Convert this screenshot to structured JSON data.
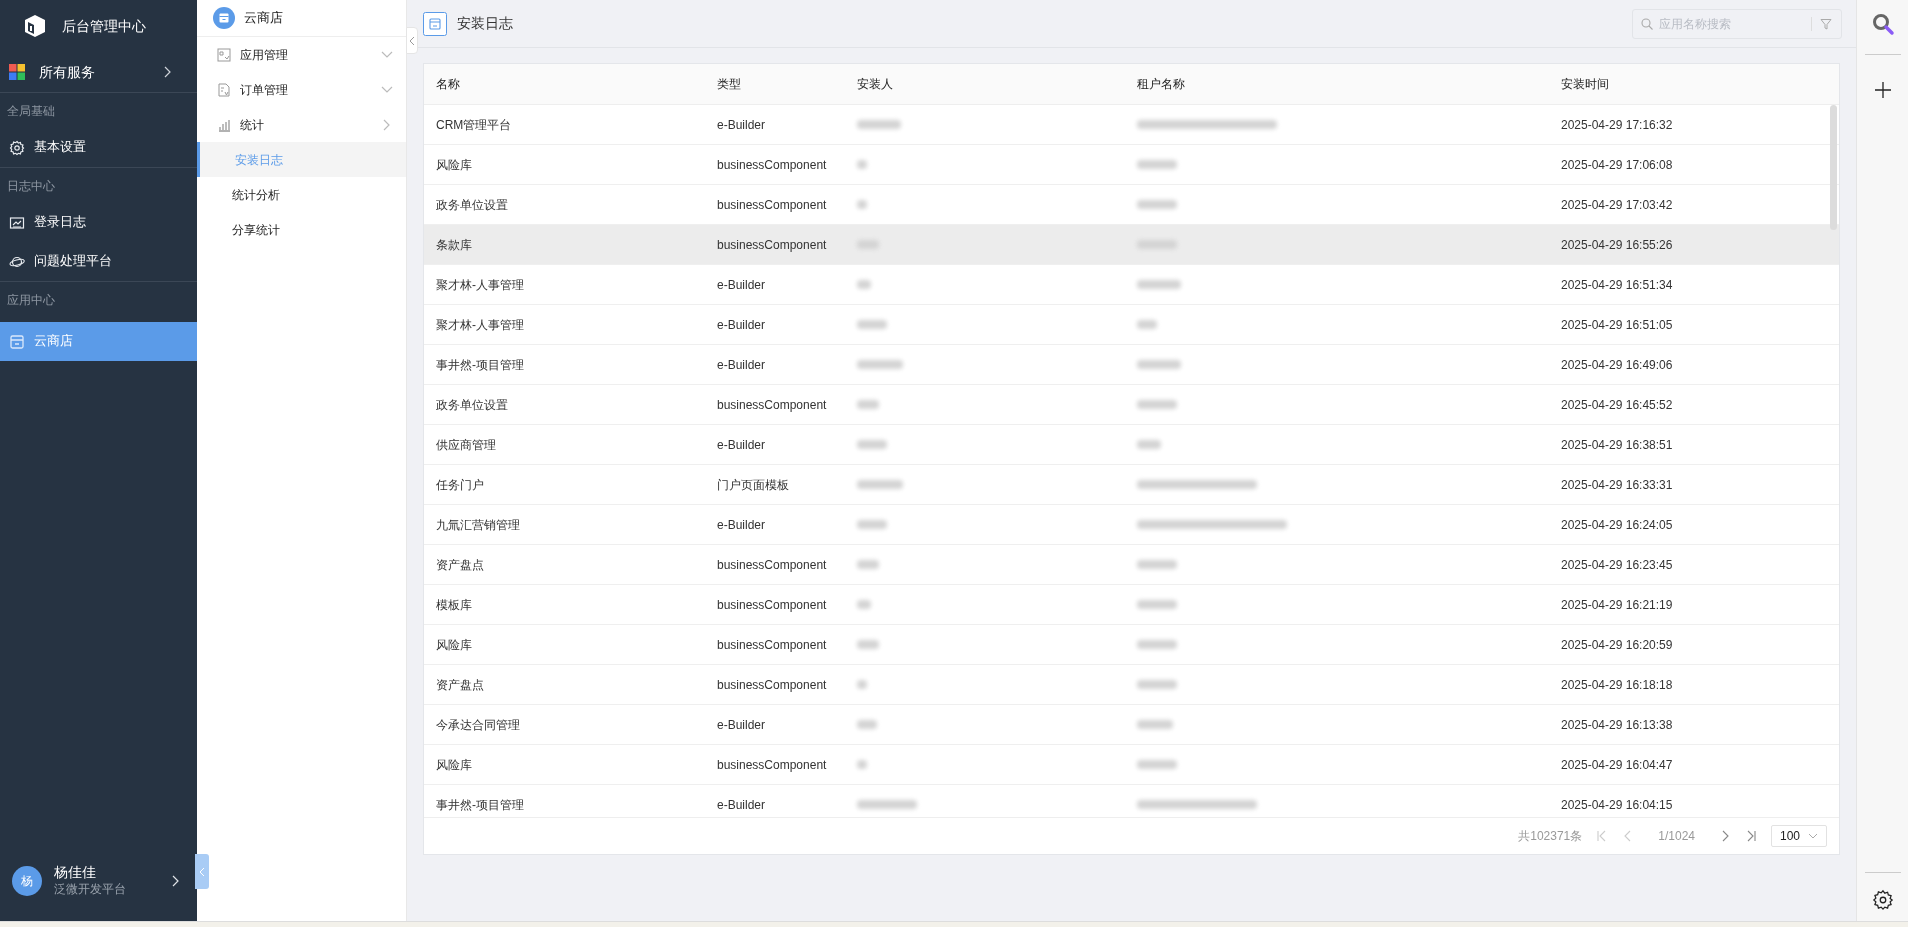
{
  "sidebar": {
    "title": "后台管理中心",
    "all_services": "所有服务",
    "sections": [
      {
        "label": "全局基础",
        "items": [
          {
            "label": "基本设置",
            "selected": false
          }
        ]
      },
      {
        "label": "日志中心",
        "items": [
          {
            "label": "登录日志",
            "selected": false
          },
          {
            "label": "问题处理平台",
            "selected": false
          }
        ]
      },
      {
        "label": "应用中心",
        "items": [
          {
            "label": "云商店",
            "selected": true
          }
        ]
      }
    ],
    "user": {
      "avatar": "杨",
      "name": "杨佳佳",
      "org": "泛微开发平台"
    }
  },
  "submenu": {
    "title": "云商店",
    "items": [
      {
        "label": "应用管理",
        "expanded": false
      },
      {
        "label": "订单管理",
        "expanded": false
      },
      {
        "label": "统计",
        "expanded": true,
        "children": [
          {
            "label": "安装日志",
            "selected": true
          },
          {
            "label": "统计分析",
            "selected": false
          },
          {
            "label": "分享统计",
            "selected": false
          }
        ]
      }
    ]
  },
  "page": {
    "title": "安装日志",
    "search": {
      "placeholder": "应用名称搜索"
    }
  },
  "table": {
    "columns": [
      "名称",
      "类型",
      "安装人",
      "租户名称",
      "安装时间"
    ],
    "rows": [
      {
        "name": "CRM管理平台",
        "type": "e-Builder",
        "time": "2025-04-29 17:16:32",
        "highlighted": false
      },
      {
        "name": "风险库",
        "type": "businessComponent",
        "time": "2025-04-29 17:06:08",
        "highlighted": false
      },
      {
        "name": "政务单位设置",
        "type": "businessComponent",
        "time": "2025-04-29 17:03:42",
        "highlighted": false
      },
      {
        "name": "条款库",
        "type": "businessComponent",
        "time": "2025-04-29 16:55:26",
        "highlighted": true
      },
      {
        "name": "聚才林-人事管理",
        "type": "e-Builder",
        "time": "2025-04-29 16:51:34",
        "highlighted": false
      },
      {
        "name": "聚才林-人事管理",
        "type": "e-Builder",
        "time": "2025-04-29 16:51:05",
        "highlighted": false
      },
      {
        "name": "事井然-项目管理",
        "type": "e-Builder",
        "time": "2025-04-29 16:49:06",
        "highlighted": false
      },
      {
        "name": "政务单位设置",
        "type": "businessComponent",
        "time": "2025-04-29 16:45:52",
        "highlighted": false
      },
      {
        "name": "供应商管理",
        "type": "e-Builder",
        "time": "2025-04-29 16:38:51",
        "highlighted": false
      },
      {
        "name": "任务门户",
        "type": "门户页面模板",
        "time": "2025-04-29 16:33:31",
        "highlighted": false
      },
      {
        "name": "九氚汇营销管理",
        "type": "e-Builder",
        "time": "2025-04-29 16:24:05",
        "highlighted": false
      },
      {
        "name": "资产盘点",
        "type": "businessComponent",
        "time": "2025-04-29 16:23:45",
        "highlighted": false
      },
      {
        "name": "模板库",
        "type": "businessComponent",
        "time": "2025-04-29 16:21:19",
        "highlighted": false
      },
      {
        "name": "风险库",
        "type": "businessComponent",
        "time": "2025-04-29 16:20:59",
        "highlighted": false
      },
      {
        "name": "资产盘点",
        "type": "businessComponent",
        "time": "2025-04-29 16:18:18",
        "highlighted": false
      },
      {
        "name": "今承达合同管理",
        "type": "e-Builder",
        "time": "2025-04-29 16:13:38",
        "highlighted": false
      },
      {
        "name": "风险库",
        "type": "businessComponent",
        "time": "2025-04-29 16:04:47",
        "highlighted": false
      },
      {
        "name": "事井然-项目管理",
        "type": "e-Builder",
        "time": "2025-04-29 16:04:15",
        "highlighted": false
      }
    ]
  },
  "pagination": {
    "total": "共102371条",
    "page": "1/1024",
    "page_size": "100"
  }
}
